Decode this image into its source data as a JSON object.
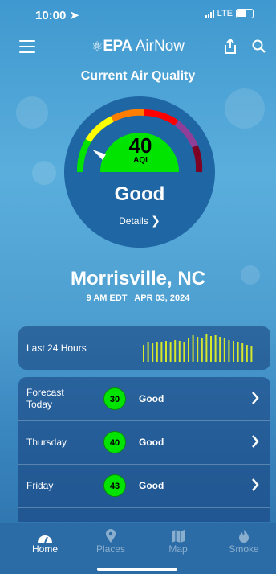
{
  "status_bar": {
    "time": "10:00",
    "network": "LTE"
  },
  "nav": {
    "brand_prefix": "EPA",
    "brand_name": "AirNow"
  },
  "current": {
    "title": "Current Air Quality",
    "aqi": "40",
    "aqi_label": "AQI",
    "category": "Good",
    "details_label": "Details",
    "city": "Morrisville, NC",
    "datetime": "9 AM EDT   APR 03, 2024"
  },
  "last24": {
    "label": "Last 24 Hours",
    "values": [
      22,
      25,
      24,
      26,
      25,
      27,
      26,
      28,
      27,
      26,
      30,
      34,
      32,
      31,
      35,
      33,
      34,
      32,
      30,
      28,
      27,
      25,
      24,
      22,
      20
    ]
  },
  "forecast": [
    {
      "day": "Forecast\nToday",
      "aqi": "30",
      "condition": "Good"
    },
    {
      "day": "Thursday",
      "aqi": "40",
      "condition": "Good"
    },
    {
      "day": "Friday",
      "aqi": "43",
      "condition": "Good"
    }
  ],
  "tabs": [
    {
      "label": "Home",
      "icon": "home-icon",
      "active": true
    },
    {
      "label": "Places",
      "icon": "location-pin-icon",
      "active": false
    },
    {
      "label": "Map",
      "icon": "map-icon",
      "active": false
    },
    {
      "label": "Smoke",
      "icon": "smoke-icon",
      "active": false
    }
  ],
  "colors": {
    "good": "#00e400",
    "moderate": "#ffff00",
    "usg": "#ff7e00",
    "unhealthy": "#ff0000",
    "very_unhealthy": "#8f3f97",
    "hazardous": "#7e0023"
  }
}
